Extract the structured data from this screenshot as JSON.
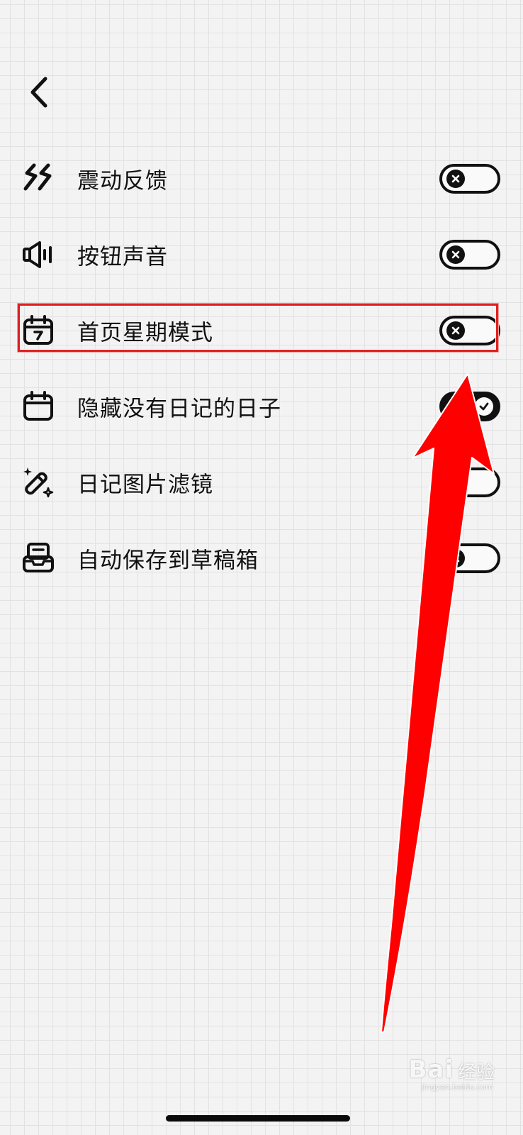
{
  "header": {
    "back_icon": "chevron-left-icon"
  },
  "settings": [
    {
      "label": "震动反馈",
      "icon": "vibration-icon",
      "toggle": "off"
    },
    {
      "label": "按钮声音",
      "icon": "speaker-icon",
      "toggle": "off"
    },
    {
      "label": "首页星期模式",
      "icon": "calendar-week-icon",
      "toggle": "off"
    },
    {
      "label": "隐藏没有日记的日子",
      "icon": "calendar-icon",
      "toggle": "on"
    },
    {
      "label": "日记图片滤镜",
      "icon": "magic-wand-icon",
      "toggle": "off"
    },
    {
      "label": "自动保存到草稿箱",
      "icon": "drafts-box-icon",
      "toggle": "off"
    }
  ],
  "annotation": {
    "highlight_color": "#e02020",
    "arrow_color": "#ff0000"
  },
  "watermark": {
    "brand": "Bai",
    "name": "经验",
    "url": "jingyan.baidu.com"
  },
  "colors": {
    "background": "#f3f3f3",
    "grid": "#e2e2e2",
    "foreground": "#111111"
  }
}
